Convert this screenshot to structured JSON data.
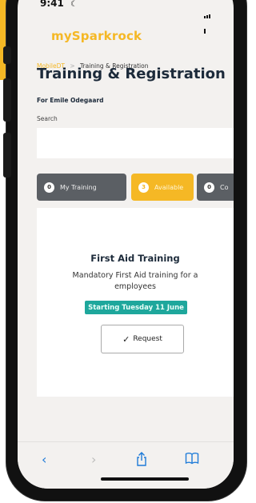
{
  "status_bar": {
    "time": "9:41"
  },
  "app": {
    "logo": "mySparkrock"
  },
  "breadcrumb": {
    "parent": "MobileDT",
    "separator": ">",
    "current": "Training & Registration"
  },
  "page": {
    "title": "Training & Registration",
    "subtitle": "For Emile Odegaard",
    "search_label": "Search",
    "search_value": ""
  },
  "tabs": [
    {
      "count": "0",
      "label": "My Training",
      "active": false
    },
    {
      "count": "3",
      "label": "Available",
      "active": true
    },
    {
      "count": "0",
      "label": "Co",
      "active": false
    }
  ],
  "card": {
    "title": "First Aid Training",
    "description_line1": "Mandatory First Aid training for a",
    "description_line2": "employees",
    "date_badge": "Starting Tuesday 11 June",
    "request_label": "Request"
  },
  "colors": {
    "accent": "#f5b825",
    "badge": "#1ea79c",
    "tab_inactive": "#5b5f64"
  },
  "safari": {
    "icons": [
      "chevron-left-icon",
      "chevron-right-icon",
      "share-icon",
      "bookmarks-icon"
    ]
  }
}
